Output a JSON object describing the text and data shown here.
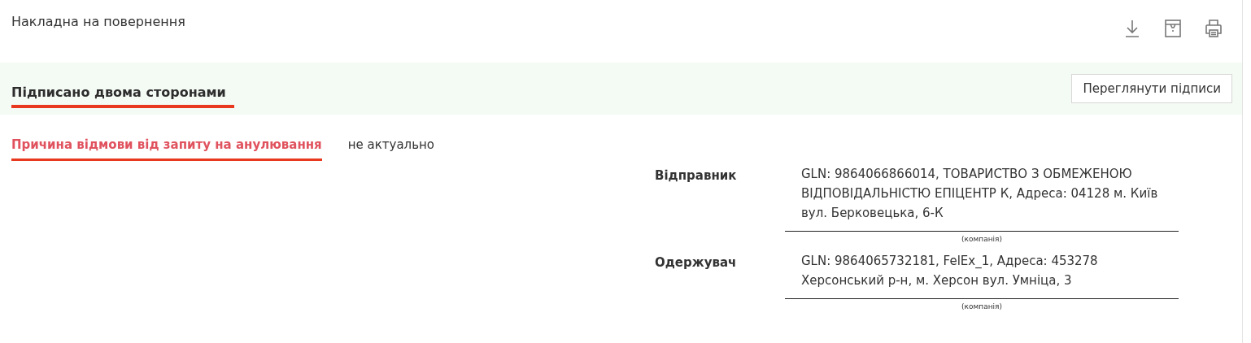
{
  "header": {
    "title": "Накладна на повернення"
  },
  "status": {
    "label": "Підписано двома сторонами",
    "button": "Переглянути підписи"
  },
  "reason": {
    "label": "Причина відмови від запиту на анулювання",
    "value": "не актуально"
  },
  "parties": [
    {
      "label": "Відправник",
      "value": "GLN: 9864066866014, ТОВАРИСТВО З ОБМЕЖЕНОЮ ВІДПОВІДАЛЬНІСТЮ ЕПІЦЕНТР К, Адреса: 04128 м. Київ вул. Берковецька, 6-К",
      "caption": "(компанія)"
    },
    {
      "label": "Одержувач",
      "value": "GLN: 9864065732181, FelEx_1, Адреса: 453278 Херсонський р-н, м. Херсон вул. Умніца, 3",
      "caption": "(компанія)"
    }
  ]
}
